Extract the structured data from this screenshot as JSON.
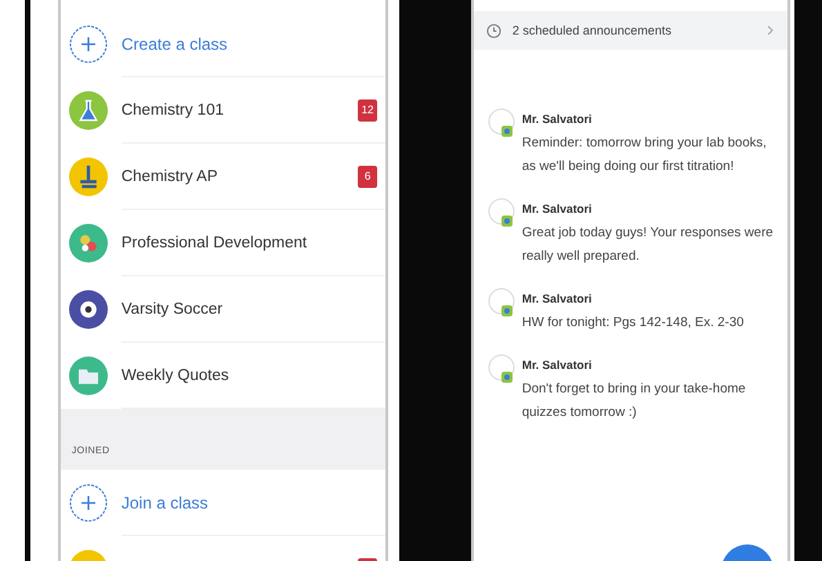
{
  "classes_screen": {
    "create_action": "Create a class",
    "owned_classes": [
      {
        "name": "Chemistry 101",
        "kind": "flask",
        "color": "#8cc540",
        "badge": "12"
      },
      {
        "name": "Chemistry AP",
        "kind": "microscope",
        "color": "#f2c500",
        "badge": "6"
      },
      {
        "name": "Professional Development",
        "kind": "puzzle",
        "color": "#3dba8c"
      },
      {
        "name": "Varsity Soccer",
        "kind": "gear",
        "color": "#4a4fa3"
      },
      {
        "name": "Weekly Quotes",
        "kind": "folder",
        "color": "#3dba8c"
      }
    ],
    "section_header": "JOINED",
    "join_action": "Join a class",
    "joined_classes": [
      {
        "color": "#f2c500",
        "has_badge": true
      }
    ]
  },
  "announcements_screen": {
    "scheduled": "2 scheduled announcements",
    "posts": [
      {
        "author": "Mr. Salvatori",
        "text": "Reminder: tomorrow bring your lab books, as we'll being doing our first titration!"
      },
      {
        "author": "Mr. Salvatori",
        "text": "Great job today guys! Your responses were really well prepared."
      },
      {
        "author": "Mr. Salvatori",
        "text": "HW for tonight: Pgs 142-148, Ex. 2-30"
      },
      {
        "author": "Mr. Salvatori",
        "text": "Don't forget to bring in your take-home quizzes tomorrow :)"
      }
    ]
  }
}
